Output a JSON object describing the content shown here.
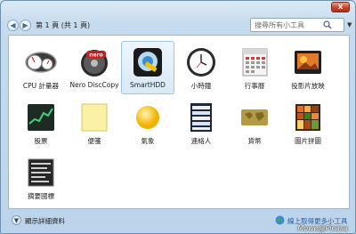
{
  "toolbar": {
    "page_label": "第 1 頁 (共 1 頁)",
    "search_placeholder": "搜尋所有小工具",
    "close_label": "x"
  },
  "gadgets": [
    {
      "label": "CPU 計量器"
    },
    {
      "label": "Nero DiscCopy"
    },
    {
      "label": "SmartHDD",
      "selected": true
    },
    {
      "label": "小時鐘"
    },
    {
      "label": "行事曆"
    },
    {
      "label": "投影片放映"
    },
    {
      "label": "股票"
    },
    {
      "label": "便箋"
    },
    {
      "label": "氣象"
    },
    {
      "label": "連絡人"
    },
    {
      "label": "貨幣"
    },
    {
      "label": "圖片拼圖"
    },
    {
      "label": "摘要國標"
    }
  ],
  "footer": {
    "details_label": "顯示詳細資料",
    "online_link": "線上取得更多小工具"
  },
  "watermark": "Mowe@Picasa"
}
